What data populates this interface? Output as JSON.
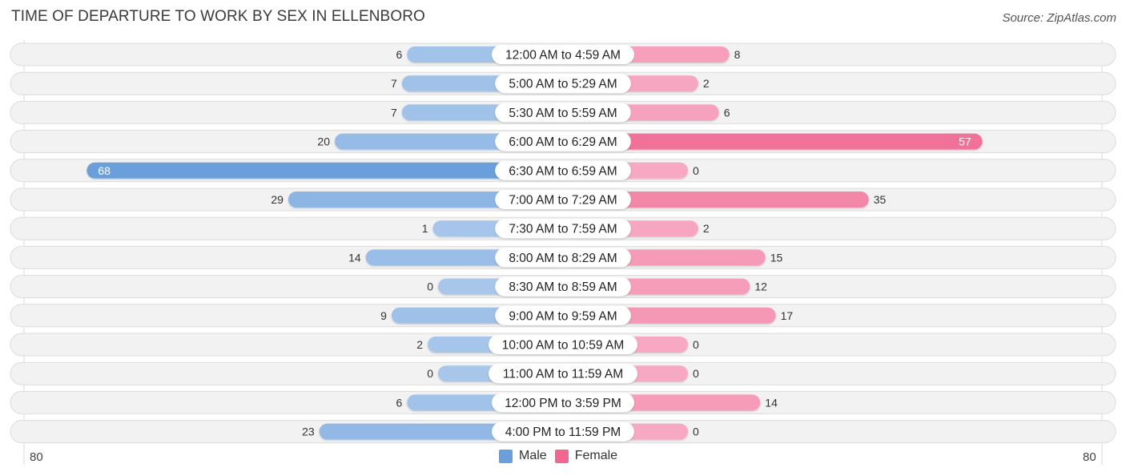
{
  "title": "TIME OF DEPARTURE TO WORK BY SEX IN ELLENBORO",
  "source": "Source: ZipAtlas.com",
  "legend": [
    {
      "label": "Male",
      "color": "#6a9fdb"
    },
    {
      "label": "Female",
      "color": "#f06890"
    }
  ],
  "axis": {
    "left_label": "80",
    "right_label": "80"
  },
  "colors": {
    "male_light": "#a7c6ea",
    "male_strong": "#6a9fdb",
    "female_light": "#f7a8c2",
    "female_strong": "#f06890",
    "row_bg": "#f2f2f2"
  },
  "chart_data": {
    "type": "bar",
    "orientation": "horizontal-diverging",
    "title": "TIME OF DEPARTURE TO WORK BY SEX IN ELLENBORO",
    "xlabel": "",
    "ylabel": "",
    "xlim": [
      -80,
      80
    ],
    "legend_position": "bottom-center",
    "categories": [
      "12:00 AM to 4:59 AM",
      "5:00 AM to 5:29 AM",
      "5:30 AM to 5:59 AM",
      "6:00 AM to 6:29 AM",
      "6:30 AM to 6:59 AM",
      "7:00 AM to 7:29 AM",
      "7:30 AM to 7:59 AM",
      "8:00 AM to 8:29 AM",
      "8:30 AM to 8:59 AM",
      "9:00 AM to 9:59 AM",
      "10:00 AM to 10:59 AM",
      "11:00 AM to 11:59 AM",
      "12:00 PM to 3:59 PM",
      "4:00 PM to 11:59 PM"
    ],
    "series": [
      {
        "name": "Male",
        "values": [
          6,
          7,
          7,
          20,
          68,
          29,
          1,
          14,
          0,
          9,
          2,
          0,
          6,
          23
        ]
      },
      {
        "name": "Female",
        "values": [
          8,
          2,
          6,
          57,
          0,
          35,
          2,
          15,
          12,
          17,
          0,
          0,
          14,
          0
        ]
      }
    ]
  }
}
